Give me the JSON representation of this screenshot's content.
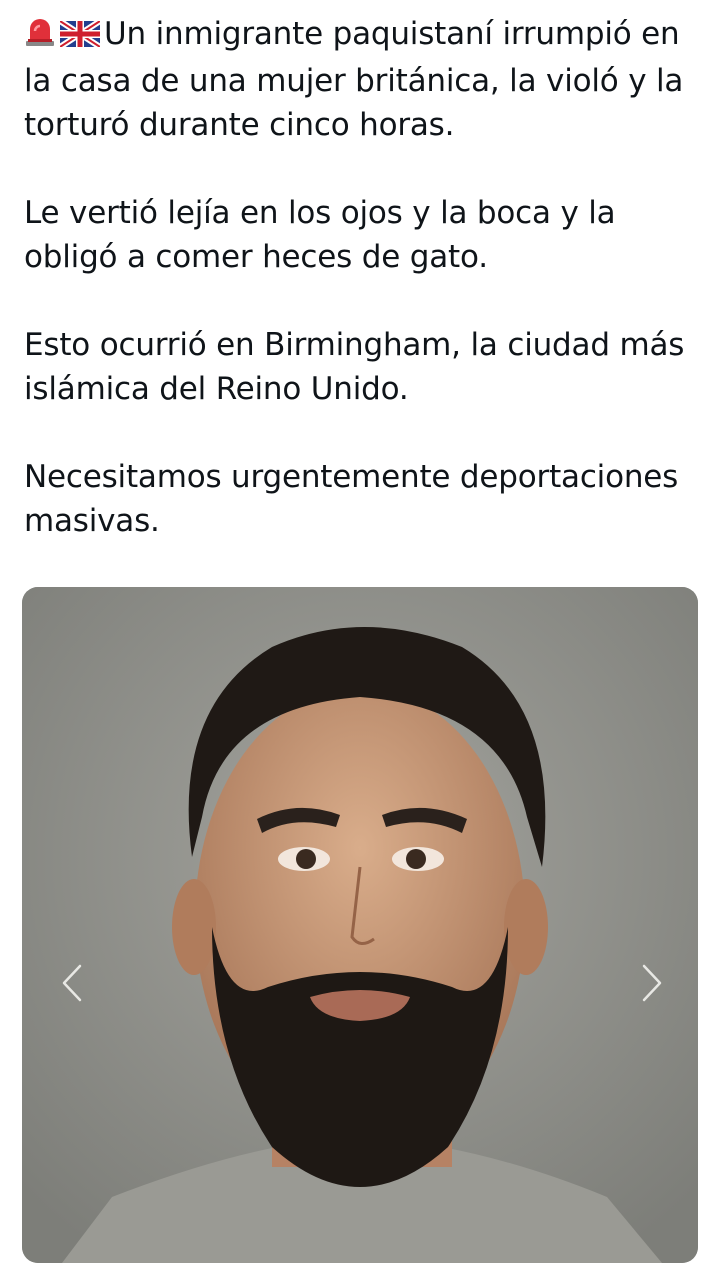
{
  "tweet": {
    "line1": "Un inmigrante paquistaní irrumpió en la casa de una mujer británica, la violó y la torturó durante cinco horas.",
    "paragraph2": "Le vertió lejía en los ojos y la boca y la obligó a comer heces de gato.",
    "paragraph3": "Esto ocurrió en Birmingham, la ciudad más islámica del Reino Unido.",
    "paragraph4": "Necesitamos urgentemente deportaciones masivas.",
    "emojis": [
      "police-light-icon",
      "uk-flag-icon"
    ]
  },
  "media": {
    "type": "photo",
    "icons": [
      "chevron-left-icon",
      "chevron-right-icon"
    ]
  }
}
